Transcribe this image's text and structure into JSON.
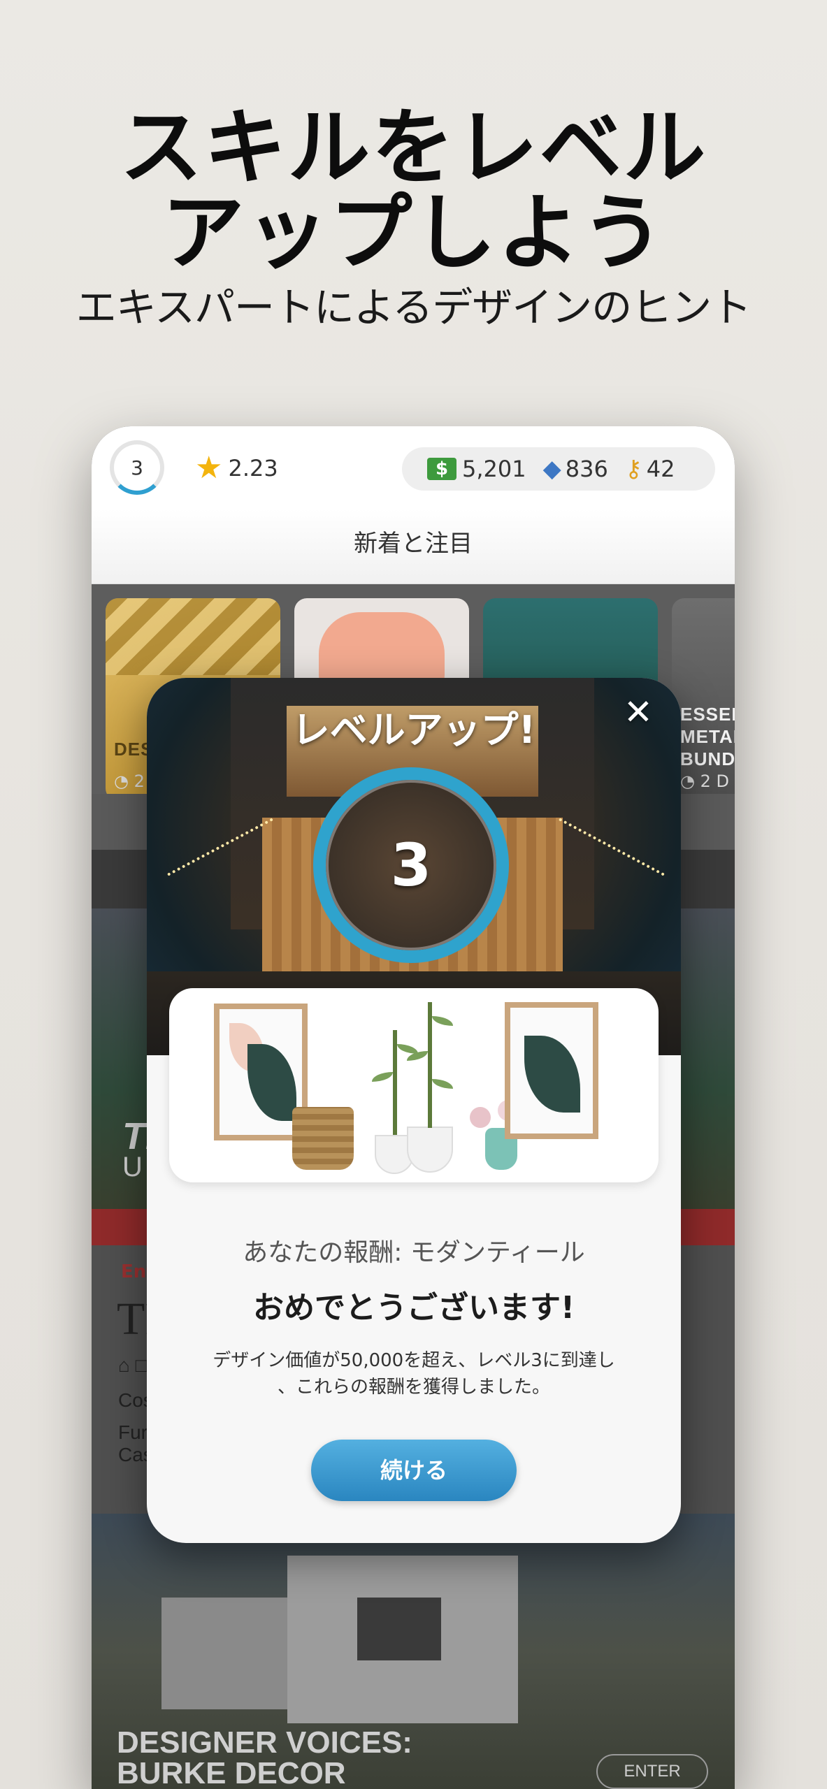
{
  "hero": {
    "title_line1": "スキルをレベル",
    "title_line2": "アップしよう",
    "subtitle": "エキスパートによるデザインのヒント"
  },
  "topbar": {
    "level": "3",
    "stars": "2.23",
    "cash": "5,201",
    "gems": "836",
    "keys": "42"
  },
  "section": {
    "title": "新着と注目"
  },
  "cards": [
    {
      "title": "DES",
      "timer": "◔ 2"
    },
    {
      "title": "",
      "timer": ""
    },
    {
      "title": "",
      "timer": ""
    },
    {
      "title": "ESSEN\nMETAL\nBUND",
      "timer": "◔ 2 D"
    }
  ],
  "background": {
    "project_title": "TI",
    "project_sub": "U",
    "enter_label": "Ent",
    "name": "TR",
    "line_icon": "⌂ □",
    "line_cost": "Cos",
    "line_fur": "Fur",
    "line_cas": "Cas",
    "voices_line1": "DESIGNER VOICES:",
    "voices_line2": "BURKE DECOR",
    "enter_button": "ENTER"
  },
  "modal": {
    "title": "レベルアップ!",
    "level": "3",
    "reward_label": "あなたの報酬: モダンティール",
    "congrats": "おめでとうございます!",
    "description_line1": "デザイン価値が50,000を超え、レベル3に到達し",
    "description_line2": "、これらの報酬を獲得しました。",
    "continue_label": "続ける"
  },
  "colors": {
    "accent": "#2fa3cd",
    "button": "#3a96cc",
    "star": "#f3b40e",
    "cash": "#3d9a3d",
    "gem": "#3d77c4",
    "key": "#e0a020"
  },
  "icons": [
    "star-icon",
    "cash-icon",
    "gem-icon",
    "key-icon",
    "close-icon"
  ]
}
